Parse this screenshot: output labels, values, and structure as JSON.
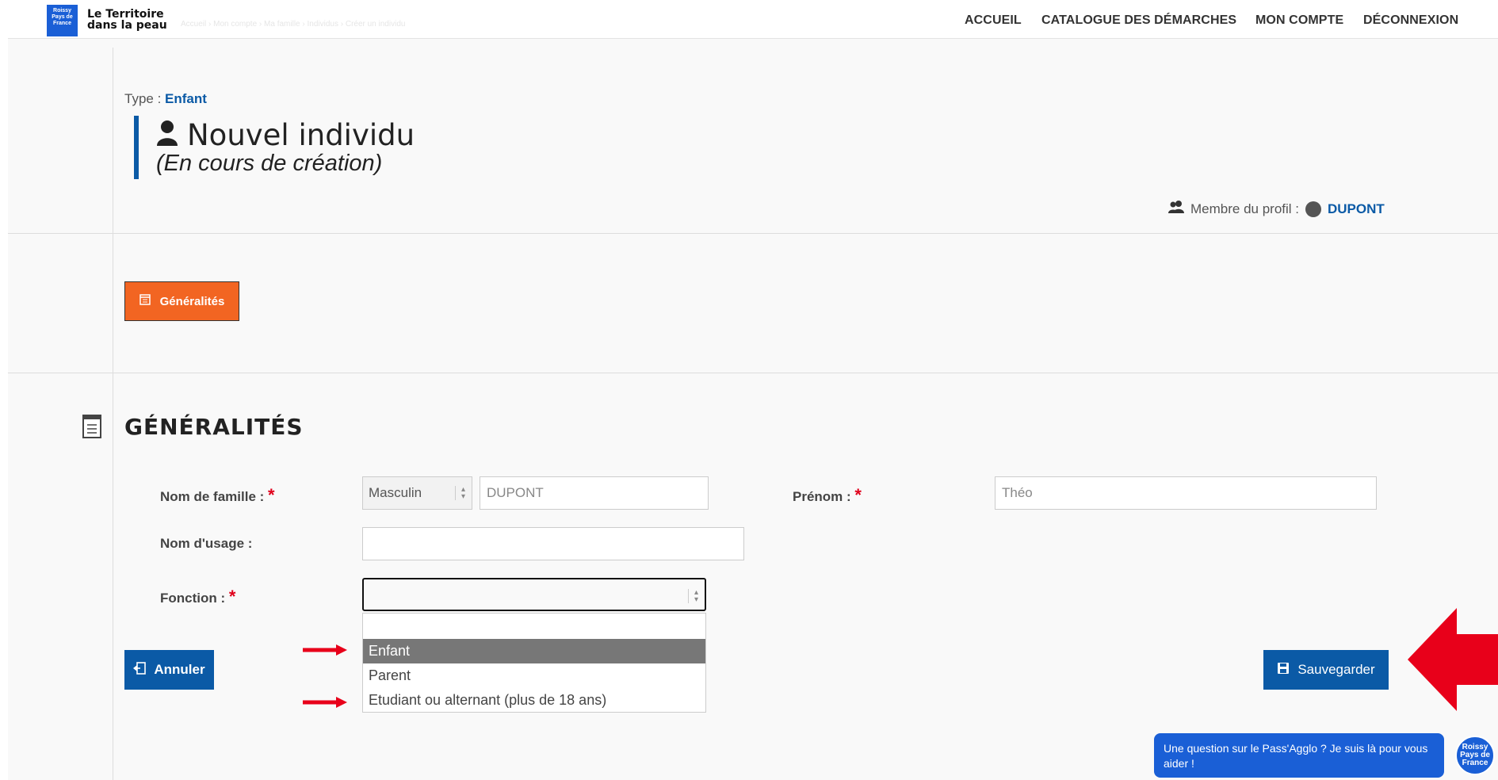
{
  "header": {
    "logo_badge": "Roissy Pays de France",
    "logo_line1": "Le Territoire",
    "logo_line2": "dans la peau",
    "breadcrumb": "Accueil › Mon compte › Ma famille › Individus › Créer un individu",
    "nav": [
      "ACCUEIL",
      "CATALOGUE DES DÉMARCHES",
      "MON COMPTE",
      "DÉCONNEXION"
    ]
  },
  "record": {
    "type_label": "Type :",
    "type_value": "Enfant",
    "title": "Nouvel individu",
    "subtitle": "(En cours de création)",
    "member_label": "Membre du profil :",
    "member_value": "DUPONT"
  },
  "tabs": {
    "generalites": "Généralités"
  },
  "section": {
    "title": "GÉNÉRALITÉS"
  },
  "form": {
    "nom_famille_label": "Nom de famille :",
    "civilite_value": "Masculin",
    "nom_famille_value": "DUPONT",
    "prenom_label": "Prénom :",
    "prenom_value": "Théo",
    "nom_usage_label": "Nom d'usage :",
    "nom_usage_value": "",
    "fonction_label": "Fonction :",
    "fonction_value": "",
    "required_mark": "*",
    "fonction_options": [
      "",
      "Enfant",
      "Parent",
      "Etudiant ou alternant (plus de 18 ans)"
    ],
    "fonction_highlighted": "Enfant"
  },
  "actions": {
    "cancel": "Annuler",
    "save": "Sauvegarder"
  },
  "chat": {
    "message": "Une question sur le Pass'Agglo ? Je suis là pour vous aider !",
    "avatar_text": "Roissy Pays de France"
  },
  "colors": {
    "primary": "#0b5aa6",
    "accent": "#f26522",
    "arrow": "#e8001a",
    "chat": "#1a5fd6"
  },
  "icons": [
    "person-icon",
    "members-icon",
    "calendar-icon",
    "document-icon",
    "exit-icon",
    "save-icon",
    "arrow-right-icon",
    "arrow-left-icon"
  ]
}
